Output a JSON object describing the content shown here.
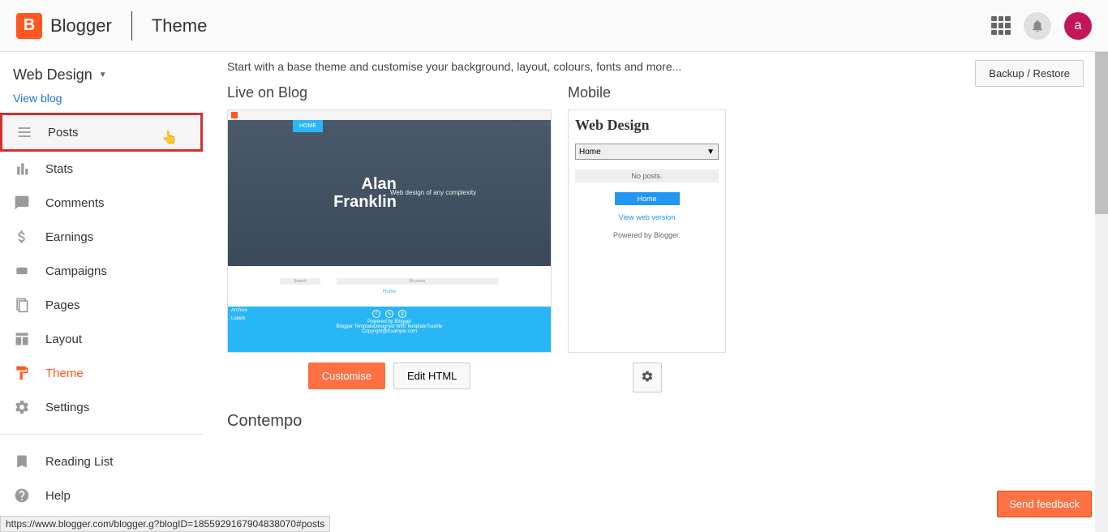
{
  "header": {
    "logo_letter": "B",
    "logo_text": "Blogger",
    "title": "Theme",
    "avatar_letter": "a"
  },
  "sidebar": {
    "blog_name": "Web Design",
    "view_blog": "View blog",
    "nav": [
      {
        "label": "Posts"
      },
      {
        "label": "Stats"
      },
      {
        "label": "Comments"
      },
      {
        "label": "Earnings"
      },
      {
        "label": "Campaigns"
      },
      {
        "label": "Pages"
      },
      {
        "label": "Layout"
      },
      {
        "label": "Theme"
      },
      {
        "label": "Settings"
      }
    ],
    "reading_list": "Reading List",
    "help": "Help"
  },
  "main": {
    "backup_restore": "Backup / Restore",
    "intro": "Start with a base theme and customise your background, layout, colours, fonts and more...",
    "live_title": "Live on Blog",
    "mobile_title": "Mobile",
    "customise": "Customise",
    "edit_html": "Edit HTML",
    "next_section": "Contempo"
  },
  "desktop_preview": {
    "home_badge": "HOME",
    "name_line1": "Alan",
    "name_line2": "Franklin",
    "subtitle": "Web design of any complexity",
    "search": "Search",
    "no_posts": "No posts.",
    "home_link": "Home",
    "archive": "Archive",
    "labels": "Labels",
    "powered": "Powered by Blogger",
    "designed": "Blogger TemplateDesigned With TemplateTuunite",
    "copyright": "Copyright@Example.com"
  },
  "mobile_preview": {
    "title": "Web Design",
    "select": "Home",
    "no_posts": "No posts.",
    "home_btn": "Home",
    "view_web": "View web version",
    "powered": "Powered by Blogger."
  },
  "feedback": "Send feedback",
  "status_url": "https://www.blogger.com/blogger.g?blogID=1855929167904838070#posts"
}
